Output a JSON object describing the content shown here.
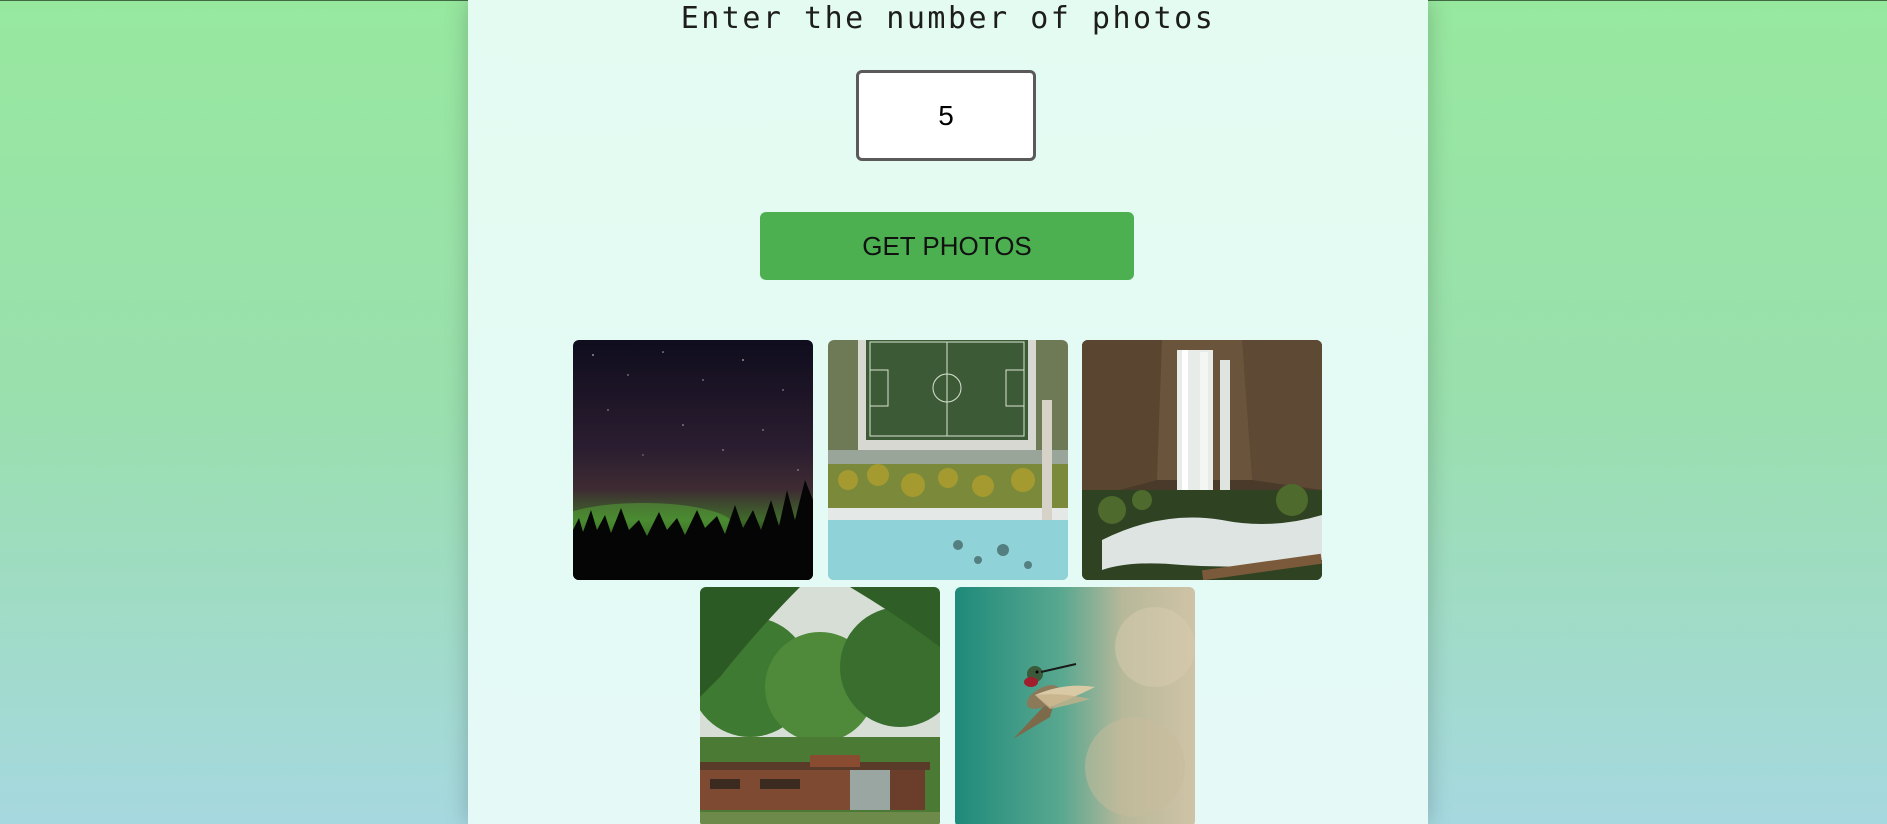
{
  "heading": "Enter the number of photos",
  "count_input": {
    "value": "5"
  },
  "get_photos_label": "GET PHOTOS",
  "photos": [
    {
      "subject": "aurora-night-sky"
    },
    {
      "subject": "aerial-soccer-field-beach"
    },
    {
      "subject": "waterfall-cliffs"
    },
    {
      "subject": "wooden-house-in-forest"
    },
    {
      "subject": "hummingbird"
    }
  ],
  "colors": {
    "page_gradient_top": "#97e89f",
    "page_gradient_bottom": "#a6d8e0",
    "panel": "#e3fbf1",
    "button": "#4caf50"
  }
}
